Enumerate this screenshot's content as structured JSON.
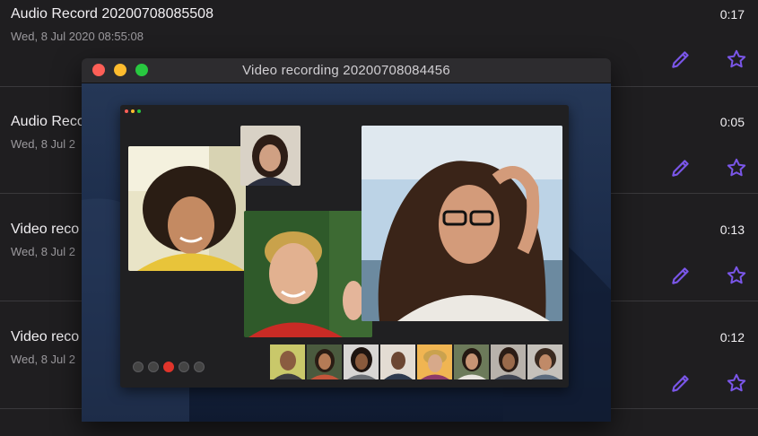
{
  "recordings": [
    {
      "title": "Audio Record 20200708085508",
      "date": "Wed, 8 Jul 2020 08:55:08",
      "duration": "0:17"
    },
    {
      "title": "Audio Record",
      "date": "Wed, 8 Jul 2",
      "duration": "0:05"
    },
    {
      "title": "Video reco",
      "date": "Wed, 8 Jul 2",
      "duration": "0:13"
    },
    {
      "title": "Video reco",
      "date": "Wed, 8 Jul 2",
      "duration": "0:12"
    }
  ],
  "player": {
    "title": "Video recording 20200708084456",
    "thumbnail_count": 8
  },
  "colors": {
    "accent": "#7a56e8",
    "background": "#1f1e20",
    "divider": "#3a393c",
    "traffic_red": "#fe5f57",
    "traffic_yellow": "#febc2e",
    "traffic_green": "#28c840"
  },
  "icons": {
    "edit": "pencil-icon",
    "favorite": "star-outline-icon"
  }
}
